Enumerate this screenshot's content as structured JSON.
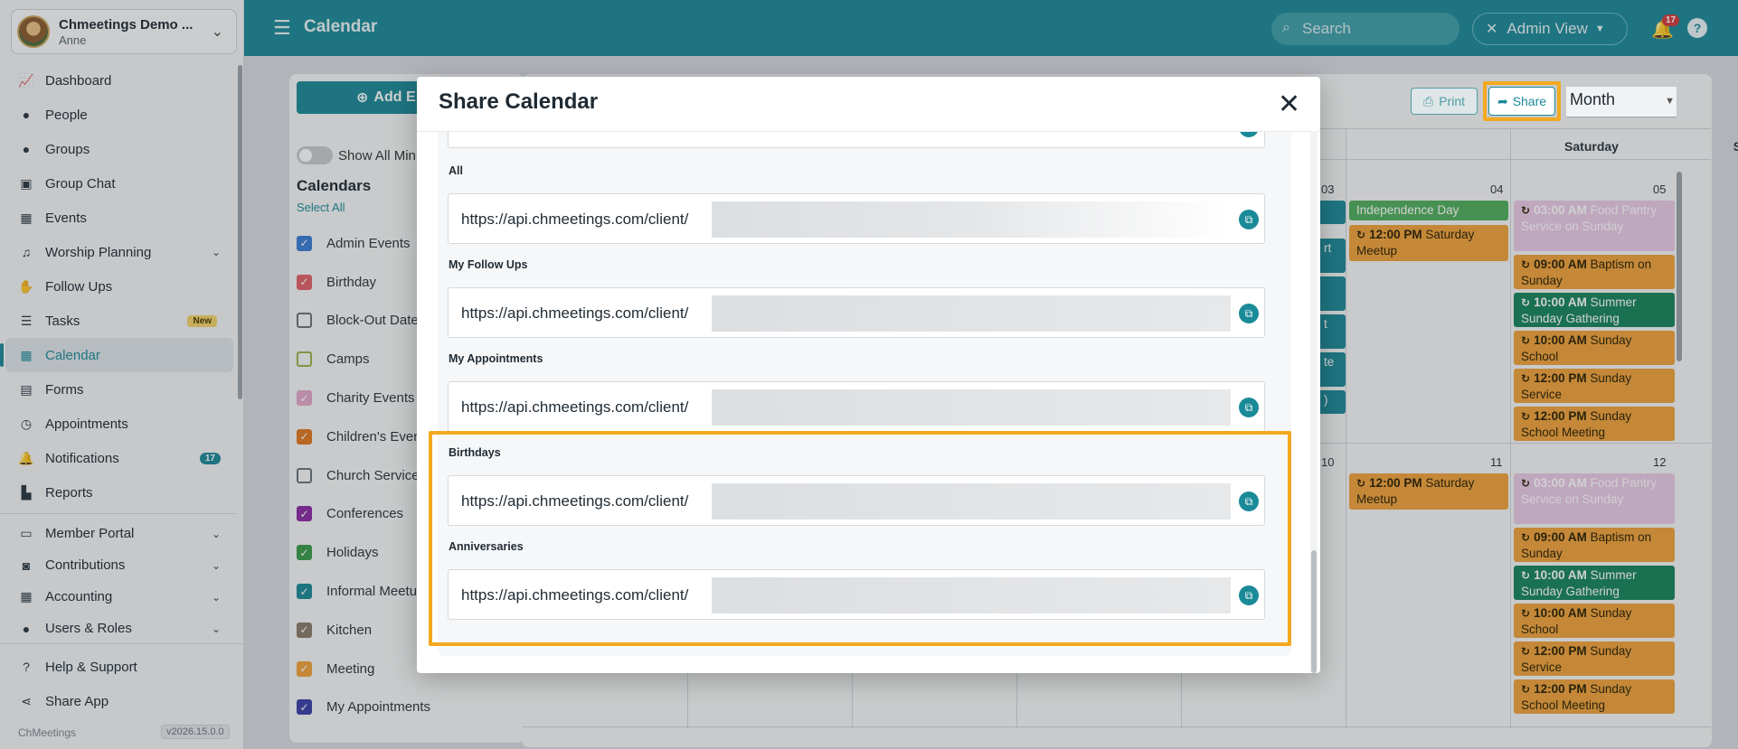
{
  "sidebar": {
    "org_name": "Chmeetings Demo ...",
    "user": "Anne",
    "items": [
      {
        "label": "Dashboard",
        "icon": "chart-line-icon"
      },
      {
        "label": "People",
        "icon": "person-icon"
      },
      {
        "label": "Groups",
        "icon": "groups-icon"
      },
      {
        "label": "Group Chat",
        "icon": "chat-icon"
      },
      {
        "label": "Events",
        "icon": "calendar-icon"
      },
      {
        "label": "Worship Planning",
        "icon": "music-icon"
      },
      {
        "label": "Follow Ups",
        "icon": "handshake-icon"
      },
      {
        "label": "Tasks",
        "icon": "tasks-icon",
        "badge": "New"
      },
      {
        "label": "Calendar",
        "icon": "calendar-icon"
      },
      {
        "label": "Forms",
        "icon": "forms-icon"
      },
      {
        "label": "Appointments",
        "icon": "clock-icon"
      },
      {
        "label": "Notifications",
        "icon": "bell-icon",
        "badge": "17"
      },
      {
        "label": "Reports",
        "icon": "reports-icon"
      },
      {
        "label": "Member Portal",
        "icon": "portal-icon"
      },
      {
        "label": "Contributions",
        "icon": "money-icon"
      },
      {
        "label": "Accounting",
        "icon": "grid-icon"
      },
      {
        "label": "Users & Roles",
        "icon": "users-icon"
      },
      {
        "label": "Help & Support",
        "icon": "help-icon"
      },
      {
        "label": "Share App",
        "icon": "share-icon"
      }
    ],
    "brand": "ChMeetings",
    "version": "v2026.15.0.0"
  },
  "topbar": {
    "title": "Calendar",
    "search_placeholder": "Search",
    "admin_view": "Admin View",
    "notif_count": "17",
    "help": "?"
  },
  "calendar_panel": {
    "add_event": "Add E",
    "show_all": "Show All Min",
    "heading": "Calendars",
    "select_all": "Select All",
    "items": [
      {
        "label": "Admin Events",
        "color": "#3a7bd5",
        "checked": true
      },
      {
        "label": "Birthday",
        "color": "#e05f68",
        "checked": true
      },
      {
        "label": "Block-Out Date",
        "color": "#6a747c",
        "checked": false
      },
      {
        "label": "Camps",
        "color": "#9bb348",
        "checked": false
      },
      {
        "label": "Charity Events",
        "color": "#e3a7c7",
        "checked": true
      },
      {
        "label": "Children's Even",
        "color": "#e0761e",
        "checked": true
      },
      {
        "label": "Church Service",
        "color": "#6a747c",
        "checked": false
      },
      {
        "label": "Conferences",
        "color": "#8a2ba5",
        "checked": true
      },
      {
        "label": "Holidays",
        "color": "#3a9a4a",
        "checked": true
      },
      {
        "label": "Informal Meetu",
        "color": "#1b8a98",
        "checked": true
      },
      {
        "label": "Kitchen",
        "color": "#8a7b6a",
        "checked": true
      },
      {
        "label": "Meeting",
        "color": "#f0a23a",
        "checked": true
      },
      {
        "label": "My Appointments",
        "color": "#3b3fa8",
        "checked": true
      }
    ]
  },
  "toolbar": {
    "print": "Print",
    "share": "Share",
    "view": "Month"
  },
  "week": {
    "saturday": "Saturday",
    "sunday": "Sunday",
    "d03": "03",
    "d04": "04",
    "d05": "05",
    "d10": "10",
    "d11": "11",
    "d12": "12"
  },
  "events": {
    "independence": "Independence Day",
    "t1200pm": "12:00 PM",
    "t0300am": "03:00 AM",
    "t0900am": "09:00 AM",
    "t1000am": "10:00 AM",
    "saturday_meetup": "Saturday Meetup",
    "food_pantry": "Food Pantry Service on Sunday",
    "baptism": "Baptism on Sunday",
    "summer_sunday": "Summer Sunday Gathering",
    "sunday_school": "Sunday School",
    "sunday_service": "Sunday Service",
    "sunday_school_meeting": "Sunday School Meeting",
    "frag_rt": "rt",
    "frag_t": "t",
    "frag_te": "te",
    "frag_paren": ")"
  },
  "modal": {
    "title": "Share Calendar",
    "url_prefix": "https://api.chmeetings.com/client/",
    "sections": [
      {
        "label": "All"
      },
      {
        "label": "My Follow Ups"
      },
      {
        "label": "My Appointments"
      },
      {
        "label": "Birthdays"
      },
      {
        "label": "Anniversaries"
      }
    ]
  }
}
